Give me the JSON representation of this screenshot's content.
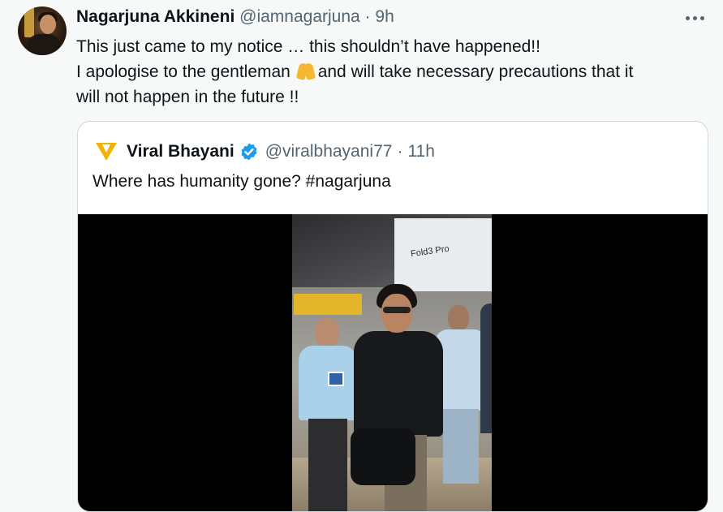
{
  "tweet": {
    "author_name": "Nagarjuna Akkineni",
    "author_handle": "@iamnagarjuna",
    "separator": "·",
    "time": "9h",
    "line1": "This just came to my notice … this shouldn’t have happened!!",
    "line2_before": "I apologise to the gentleman ",
    "line2_after": "and will take necessary precautions that it",
    "line3": "will not happen in the future !!"
  },
  "quoted": {
    "author_name": "Viral Bhayani",
    "author_handle": "@viralbhayani77",
    "separator": "·",
    "time": "11h",
    "text": "Where has humanity gone? #nagarjuna"
  },
  "media": {
    "banner_text": "Fold3 Pro"
  },
  "icons": {
    "more": "more-horizontal-icon",
    "verified": "verified-badge-icon",
    "emoji": "folded-hands-emoji"
  },
  "colors": {
    "background": "#f7f9f9",
    "secondary_text": "#536471",
    "verified_blue": "#1d9bf0",
    "card_border": "#cfd9de"
  }
}
